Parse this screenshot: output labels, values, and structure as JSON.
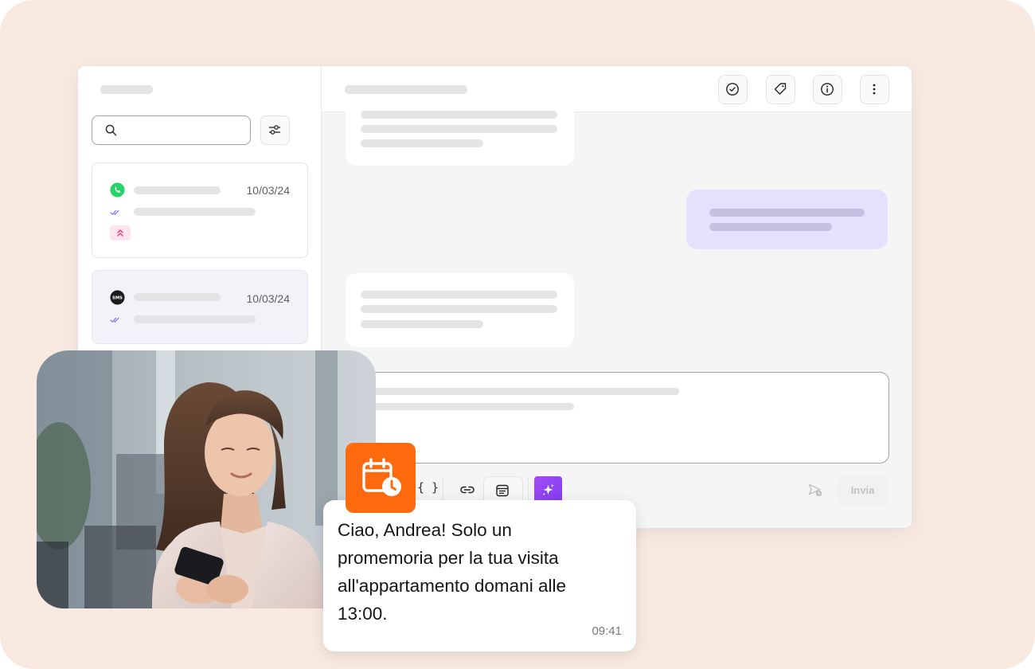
{
  "conversations": [
    {
      "channel": "whatsapp",
      "date": "10/03/24",
      "has_priority": true,
      "active": false
    },
    {
      "channel": "sms",
      "channel_label": "SMS",
      "date": "10/03/24",
      "has_priority": false,
      "active": true
    }
  ],
  "header": {
    "actions": [
      "check-circle-icon",
      "tag-icon",
      "info-icon",
      "more-vertical-icon"
    ]
  },
  "composer": {
    "variables_label": "{ }",
    "send_label": "Invia"
  },
  "notification": {
    "message": "Ciao, Andrea! Solo un promemoria per la tua visita all'appartamento domani alle 13:00.",
    "time": "09:41",
    "icon": "calendar-clock-icon"
  },
  "colors": {
    "background": "#f8eae0",
    "outgoing_bubble": "#e7e0fd",
    "accent_orange": "#ff6a0f",
    "ai_purple": "#9146f3",
    "whatsapp_green": "#25d366"
  }
}
